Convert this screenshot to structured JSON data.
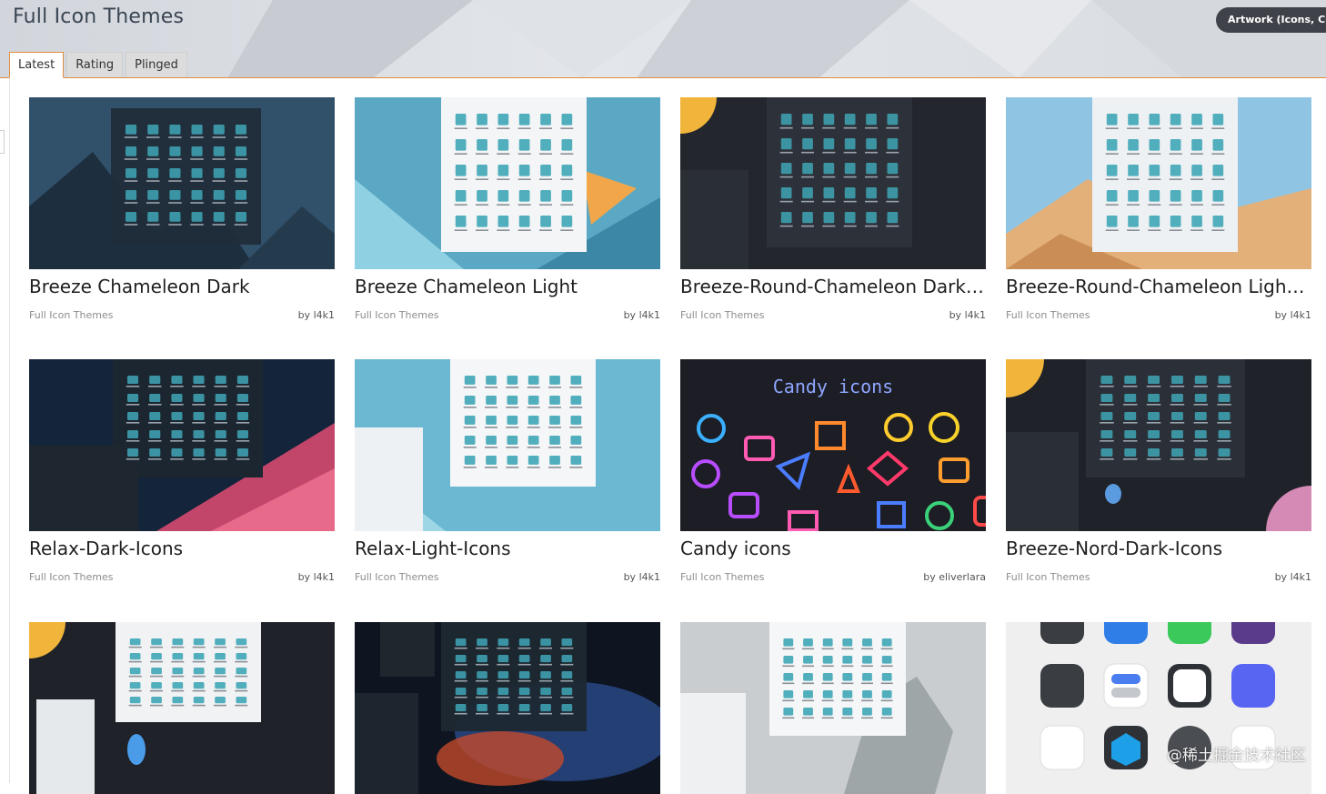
{
  "page": {
    "title": "Full Icon Themes",
    "category_pill": "Artwork (Icons, Curso"
  },
  "tabs": [
    "Latest",
    "Rating",
    "Plinged"
  ],
  "cards": [
    {
      "title": "Breeze Chameleon Dark",
      "category": "Full Icon Themes",
      "by_prefix": "by",
      "author": "l4k1"
    },
    {
      "title": "Breeze Chameleon Light",
      "category": "Full Icon Themes",
      "by_prefix": "by",
      "author": "l4k1"
    },
    {
      "title": "Breeze-Round-Chameleon Dark Ic...",
      "category": "Full Icon Themes",
      "by_prefix": "by",
      "author": "l4k1"
    },
    {
      "title": "Breeze-Round-Chameleon Light Ic...",
      "category": "Full Icon Themes",
      "by_prefix": "by",
      "author": "l4k1"
    },
    {
      "title": "Relax-Dark-Icons",
      "category": "Full Icon Themes",
      "by_prefix": "by",
      "author": "l4k1"
    },
    {
      "title": "Relax-Light-Icons",
      "category": "Full Icon Themes",
      "by_prefix": "by",
      "author": "l4k1"
    },
    {
      "title": "Candy icons",
      "category": "Full Icon Themes",
      "by_prefix": "by",
      "author": "eliverlara"
    },
    {
      "title": "Breeze-Nord-Dark-Icons",
      "category": "Full Icon Themes",
      "by_prefix": "by",
      "author": "l4k1"
    },
    {
      "title": "",
      "category": "",
      "by_prefix": "",
      "author": ""
    },
    {
      "title": "",
      "category": "",
      "by_prefix": "",
      "author": ""
    },
    {
      "title": "",
      "category": "",
      "by_prefix": "",
      "author": ""
    },
    {
      "title": "",
      "category": "",
      "by_prefix": "",
      "author": ""
    }
  ],
  "thumb_text": {
    "candy_label": "Candy icons"
  },
  "watermark": "@稀土掘金技术社区",
  "colors": {
    "accent_orange": "#e08d3c",
    "pill_dark": "#3f4349",
    "title_text": "#1f1f1f",
    "meta_text": "#8d8d8d",
    "folder_teal": "#3fa6b6"
  }
}
